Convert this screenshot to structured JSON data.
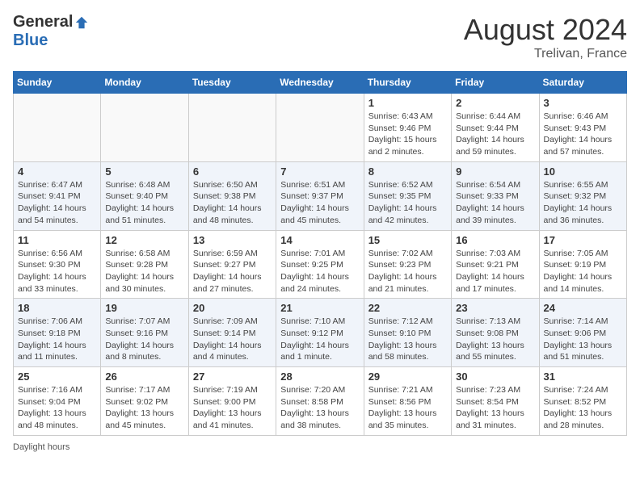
{
  "header": {
    "logo_general": "General",
    "logo_blue": "Blue",
    "month_title": "August 2024",
    "location": "Trelivan, France"
  },
  "days_of_week": [
    "Sunday",
    "Monday",
    "Tuesday",
    "Wednesday",
    "Thursday",
    "Friday",
    "Saturday"
  ],
  "footer": {
    "daylight_label": "Daylight hours"
  },
  "weeks": [
    {
      "days": [
        {
          "num": "",
          "info": ""
        },
        {
          "num": "",
          "info": ""
        },
        {
          "num": "",
          "info": ""
        },
        {
          "num": "",
          "info": ""
        },
        {
          "num": "1",
          "info": "Sunrise: 6:43 AM\nSunset: 9:46 PM\nDaylight: 15 hours\nand 2 minutes."
        },
        {
          "num": "2",
          "info": "Sunrise: 6:44 AM\nSunset: 9:44 PM\nDaylight: 14 hours\nand 59 minutes."
        },
        {
          "num": "3",
          "info": "Sunrise: 6:46 AM\nSunset: 9:43 PM\nDaylight: 14 hours\nand 57 minutes."
        }
      ]
    },
    {
      "days": [
        {
          "num": "4",
          "info": "Sunrise: 6:47 AM\nSunset: 9:41 PM\nDaylight: 14 hours\nand 54 minutes."
        },
        {
          "num": "5",
          "info": "Sunrise: 6:48 AM\nSunset: 9:40 PM\nDaylight: 14 hours\nand 51 minutes."
        },
        {
          "num": "6",
          "info": "Sunrise: 6:50 AM\nSunset: 9:38 PM\nDaylight: 14 hours\nand 48 minutes."
        },
        {
          "num": "7",
          "info": "Sunrise: 6:51 AM\nSunset: 9:37 PM\nDaylight: 14 hours\nand 45 minutes."
        },
        {
          "num": "8",
          "info": "Sunrise: 6:52 AM\nSunset: 9:35 PM\nDaylight: 14 hours\nand 42 minutes."
        },
        {
          "num": "9",
          "info": "Sunrise: 6:54 AM\nSunset: 9:33 PM\nDaylight: 14 hours\nand 39 minutes."
        },
        {
          "num": "10",
          "info": "Sunrise: 6:55 AM\nSunset: 9:32 PM\nDaylight: 14 hours\nand 36 minutes."
        }
      ]
    },
    {
      "days": [
        {
          "num": "11",
          "info": "Sunrise: 6:56 AM\nSunset: 9:30 PM\nDaylight: 14 hours\nand 33 minutes."
        },
        {
          "num": "12",
          "info": "Sunrise: 6:58 AM\nSunset: 9:28 PM\nDaylight: 14 hours\nand 30 minutes."
        },
        {
          "num": "13",
          "info": "Sunrise: 6:59 AM\nSunset: 9:27 PM\nDaylight: 14 hours\nand 27 minutes."
        },
        {
          "num": "14",
          "info": "Sunrise: 7:01 AM\nSunset: 9:25 PM\nDaylight: 14 hours\nand 24 minutes."
        },
        {
          "num": "15",
          "info": "Sunrise: 7:02 AM\nSunset: 9:23 PM\nDaylight: 14 hours\nand 21 minutes."
        },
        {
          "num": "16",
          "info": "Sunrise: 7:03 AM\nSunset: 9:21 PM\nDaylight: 14 hours\nand 17 minutes."
        },
        {
          "num": "17",
          "info": "Sunrise: 7:05 AM\nSunset: 9:19 PM\nDaylight: 14 hours\nand 14 minutes."
        }
      ]
    },
    {
      "days": [
        {
          "num": "18",
          "info": "Sunrise: 7:06 AM\nSunset: 9:18 PM\nDaylight: 14 hours\nand 11 minutes."
        },
        {
          "num": "19",
          "info": "Sunrise: 7:07 AM\nSunset: 9:16 PM\nDaylight: 14 hours\nand 8 minutes."
        },
        {
          "num": "20",
          "info": "Sunrise: 7:09 AM\nSunset: 9:14 PM\nDaylight: 14 hours\nand 4 minutes."
        },
        {
          "num": "21",
          "info": "Sunrise: 7:10 AM\nSunset: 9:12 PM\nDaylight: 14 hours\nand 1 minute."
        },
        {
          "num": "22",
          "info": "Sunrise: 7:12 AM\nSunset: 9:10 PM\nDaylight: 13 hours\nand 58 minutes."
        },
        {
          "num": "23",
          "info": "Sunrise: 7:13 AM\nSunset: 9:08 PM\nDaylight: 13 hours\nand 55 minutes."
        },
        {
          "num": "24",
          "info": "Sunrise: 7:14 AM\nSunset: 9:06 PM\nDaylight: 13 hours\nand 51 minutes."
        }
      ]
    },
    {
      "days": [
        {
          "num": "25",
          "info": "Sunrise: 7:16 AM\nSunset: 9:04 PM\nDaylight: 13 hours\nand 48 minutes."
        },
        {
          "num": "26",
          "info": "Sunrise: 7:17 AM\nSunset: 9:02 PM\nDaylight: 13 hours\nand 45 minutes."
        },
        {
          "num": "27",
          "info": "Sunrise: 7:19 AM\nSunset: 9:00 PM\nDaylight: 13 hours\nand 41 minutes."
        },
        {
          "num": "28",
          "info": "Sunrise: 7:20 AM\nSunset: 8:58 PM\nDaylight: 13 hours\nand 38 minutes."
        },
        {
          "num": "29",
          "info": "Sunrise: 7:21 AM\nSunset: 8:56 PM\nDaylight: 13 hours\nand 35 minutes."
        },
        {
          "num": "30",
          "info": "Sunrise: 7:23 AM\nSunset: 8:54 PM\nDaylight: 13 hours\nand 31 minutes."
        },
        {
          "num": "31",
          "info": "Sunrise: 7:24 AM\nSunset: 8:52 PM\nDaylight: 13 hours\nand 28 minutes."
        }
      ]
    }
  ]
}
